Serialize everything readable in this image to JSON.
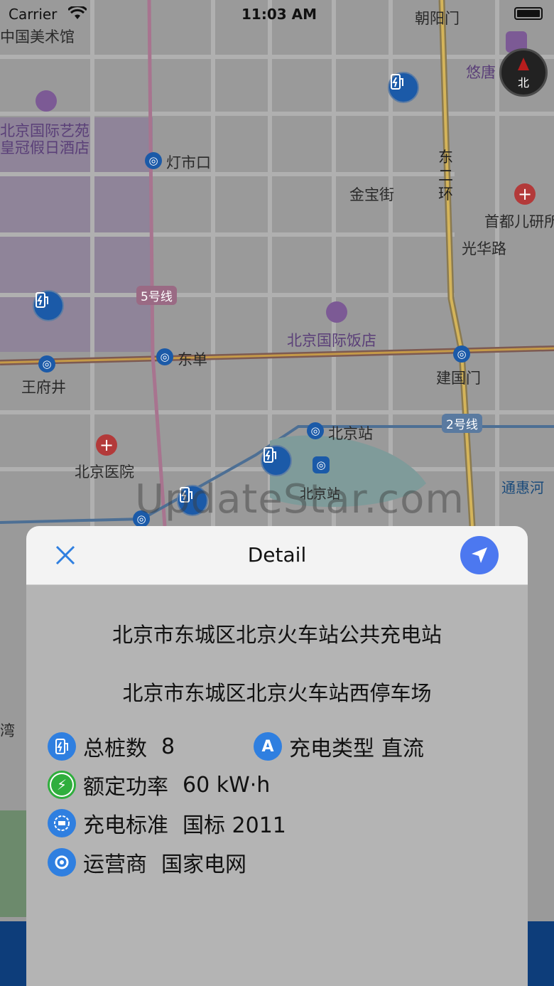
{
  "status_bar": {
    "carrier": "Carrier",
    "time": "11:03 AM"
  },
  "map": {
    "labels": {
      "art_museum": "中国美术馆",
      "chaoyangmen": "朝阳门",
      "youtang": "悠唐",
      "hotel_line1": "北京国际艺苑",
      "hotel_line2": "皇冠假日酒店",
      "dengshikou": "灯市口",
      "east_ring": "东二环",
      "jinbaojie": "金宝街",
      "children_hospital": "首都儿研所",
      "guanghualu": "光华路",
      "line5": "5号线",
      "intl_hotel": "北京国际饭店",
      "dongdan": "东单",
      "jianguomen": "建国门",
      "wangfujing": "王府井",
      "line2": "2号线",
      "beijingzhan_metro": "北京站",
      "beijing_hospital": "北京医院",
      "beijingzhan": "北京站",
      "tonghuihe": "通惠河",
      "wan": "湾"
    },
    "compass_label": "北",
    "watermark": "UpdateStar.com"
  },
  "detail": {
    "title": "Detail",
    "station_name": "北京市东城区北京火车站公共充电站",
    "address": "北京市东城区北京火车站西停车场",
    "total_piles_label": "总桩数",
    "total_piles_value": "8",
    "charge_type_label": "充电类型",
    "charge_type_value": "直流",
    "power_label": "额定功率",
    "power_value": "60 kW·h",
    "standard_label": "充电标准",
    "standard_value": "国标 2011",
    "operator_label": "运营商",
    "operator_value": "国家电网",
    "charge_type_icon_letter": "A"
  },
  "icons": {
    "close": "close-icon",
    "navigate": "navigate-arrow-icon",
    "pile": "charging-pile-icon",
    "type": "charge-type-icon",
    "power": "lightning-icon",
    "standard": "standard-icon",
    "operator": "operator-icon"
  },
  "colors": {
    "accent": "#4c78f0",
    "icon_blue": "#2f7fe0",
    "icon_green": "#2fae3d"
  }
}
